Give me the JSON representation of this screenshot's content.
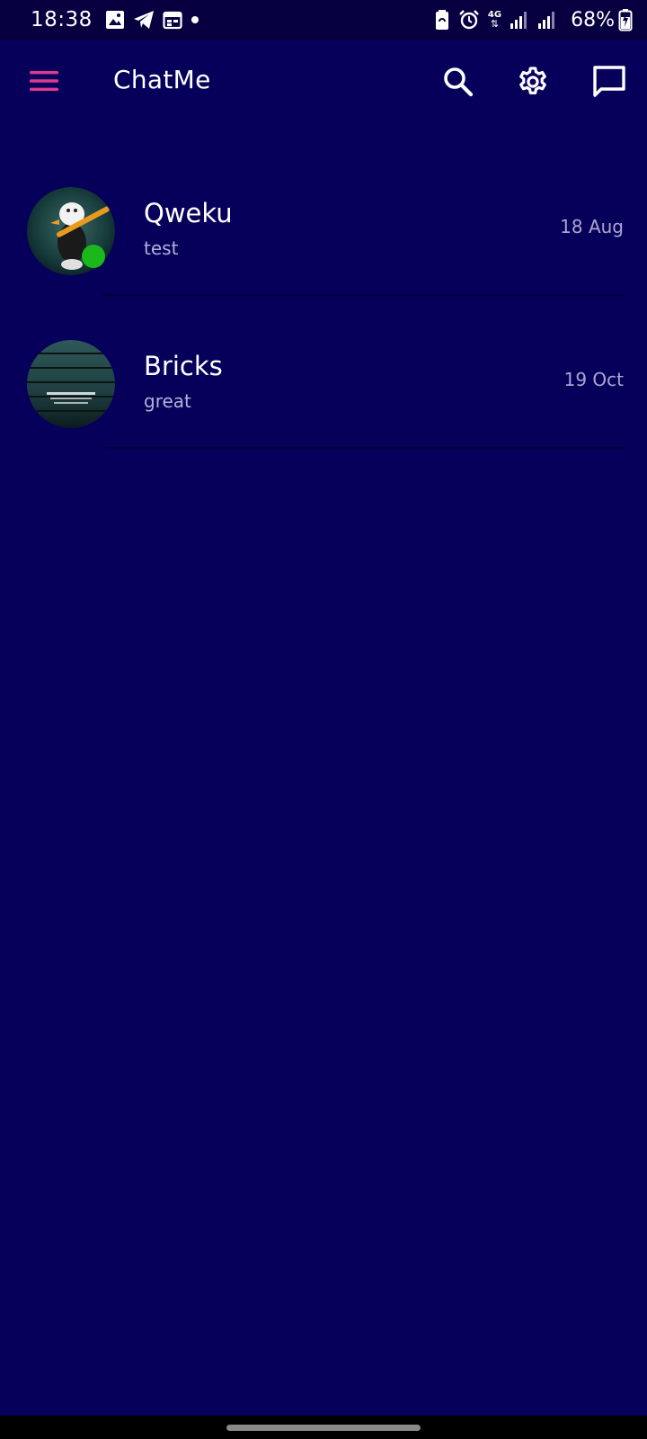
{
  "status_bar": {
    "time": "18:38",
    "network": "4G",
    "battery": "68%"
  },
  "app_bar": {
    "title": "ChatMe",
    "menu_icon": "hamburger-menu-icon",
    "actions": [
      {
        "name": "search",
        "icon": "search-icon"
      },
      {
        "name": "settings",
        "icon": "gear-icon"
      },
      {
        "name": "new-chat",
        "icon": "chat-bubble-icon"
      }
    ]
  },
  "chats": [
    {
      "name": "Qweku",
      "preview": "test",
      "date": "18 Aug",
      "online": true
    },
    {
      "name": "Bricks",
      "preview": "great",
      "date": "19 Oct",
      "online": false
    }
  ],
  "colors": {
    "background": "#07005a",
    "status_bar": "#060040",
    "accent": "#e0388f",
    "online": "#1ab81a"
  }
}
